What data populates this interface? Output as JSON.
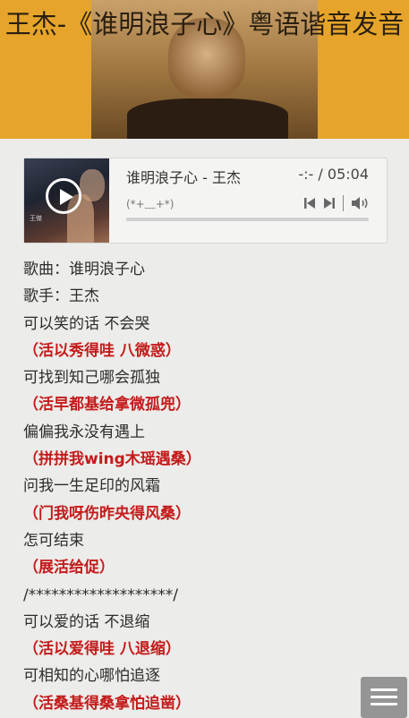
{
  "header": {
    "title": "王杰-《谁明浪子心》粤语谐音发音"
  },
  "player": {
    "track": "谁明浪子心 - 王杰",
    "time": "-:- / 05:04",
    "subtitle": "(*+﹏+*)",
    "progress": 0
  },
  "lyrics": [
    {
      "text": "歌曲：谁明浪子心",
      "type": "info"
    },
    {
      "text": "歌手：王杰",
      "type": "info"
    },
    {
      "text": "可以笑的话 不会哭",
      "type": "mandarin"
    },
    {
      "text": "（活以秀得哇 八微惑）",
      "type": "cantonese"
    },
    {
      "text": "可找到知己哪会孤独",
      "type": "mandarin"
    },
    {
      "text": "（活早都基给拿微孤兜）",
      "type": "cantonese"
    },
    {
      "text": "偏偏我永没有遇上",
      "type": "mandarin"
    },
    {
      "text": "（拼拼我wing木瑶遇桑）",
      "type": "cantonese"
    },
    {
      "text": "问我一生足印的风霜",
      "type": "mandarin"
    },
    {
      "text": "（门我呀伤昨央得风桑）",
      "type": "cantonese"
    },
    {
      "text": "怎可结束",
      "type": "mandarin"
    },
    {
      "text": "（展活给促）",
      "type": "cantonese"
    },
    {
      "text": "/*******************/",
      "type": "separator"
    },
    {
      "text": "可以爱的话 不退缩",
      "type": "mandarin"
    },
    {
      "text": "（活以爱得哇 八退缩）",
      "type": "cantonese"
    },
    {
      "text": "可相知的心哪怕追逐",
      "type": "mandarin"
    },
    {
      "text": "（活桑基得桑拿怕追凿）",
      "type": "cantonese"
    }
  ],
  "colors": {
    "banner": "#e6a52a",
    "cantonese": "#c41a1a",
    "background": "#ececea"
  }
}
